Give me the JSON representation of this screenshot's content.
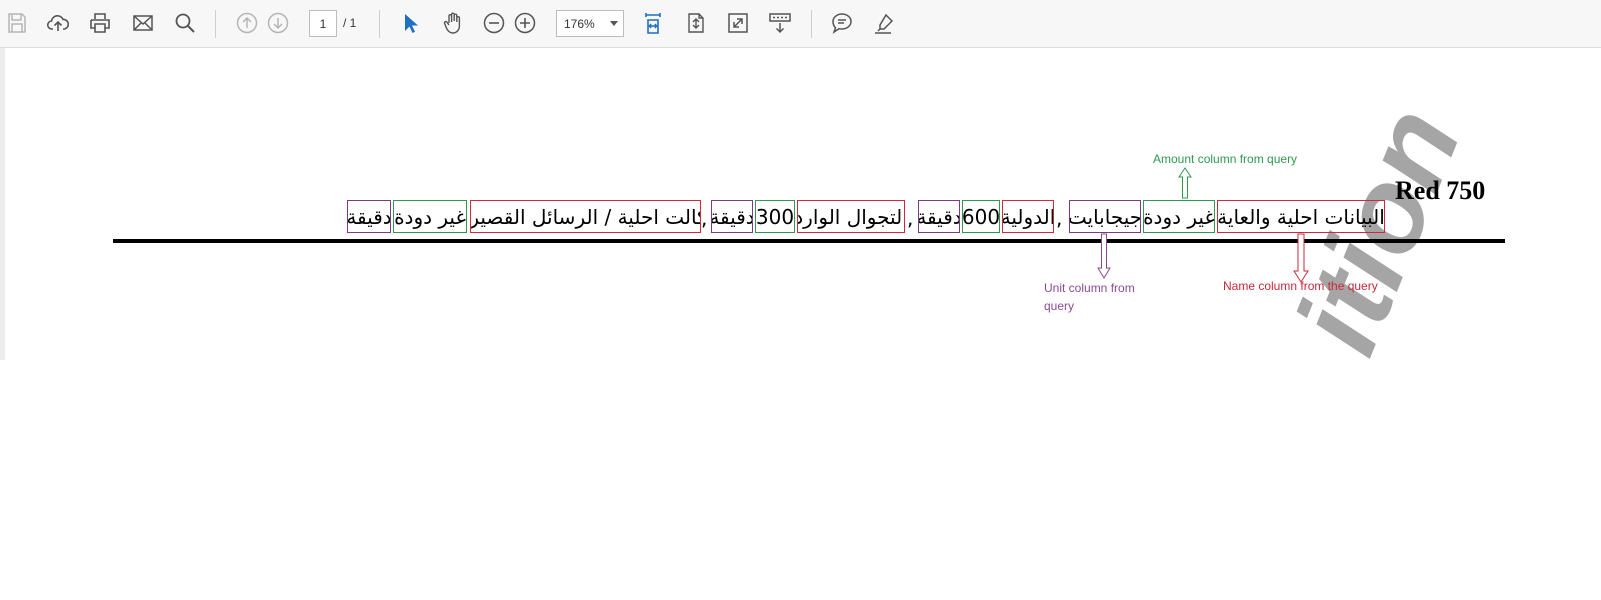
{
  "toolbar": {
    "page_current": "1",
    "page_total": "/ 1",
    "zoom": "176%",
    "icons": [
      "save-icon",
      "upload-icon",
      "print-icon",
      "mail-icon",
      "search-icon",
      "page-up-icon",
      "page-down-icon",
      "select-arrow-icon",
      "hand-tool-icon",
      "zoom-out-icon",
      "zoom-in-icon",
      "fit-width-icon",
      "rotate-icon",
      "fullscreen-icon",
      "scroll-mode-icon",
      "comment-icon",
      "highlight-icon"
    ]
  },
  "document": {
    "title": "Red 750",
    "segments": [
      {
        "text": "البيانات احلية والعاية",
        "kind": "name"
      },
      {
        "text": "غير دودة",
        "kind": "amount"
      },
      {
        "text": "جيجابايت",
        "kind": "unit"
      },
      {
        "text": "الدولية",
        "kind": "name"
      },
      {
        "text": "600",
        "kind": "amount"
      },
      {
        "text": "دقيقة",
        "kind": "unit"
      },
      {
        "text": "التجوال الوارد",
        "kind": "name"
      },
      {
        "text": "300",
        "kind": "amount"
      },
      {
        "text": "دقيقة",
        "kind": "unit"
      },
      {
        "text": "اكالت احلية / الرسائل القصيرة",
        "kind": "name"
      },
      {
        "text": "غير دودة",
        "kind": "amount"
      },
      {
        "text": "دقيقة",
        "kind": "unit"
      }
    ],
    "commas": [
      ",",
      ",",
      ","
    ],
    "annotations": {
      "amount": "Amount column from query",
      "unit_line1": "Unit column from",
      "unit_line2": "query",
      "name": "Name column from the query"
    },
    "colors": {
      "name": "#d2283b",
      "amount": "#2f9a4e",
      "unit": "#7a3a85"
    }
  }
}
